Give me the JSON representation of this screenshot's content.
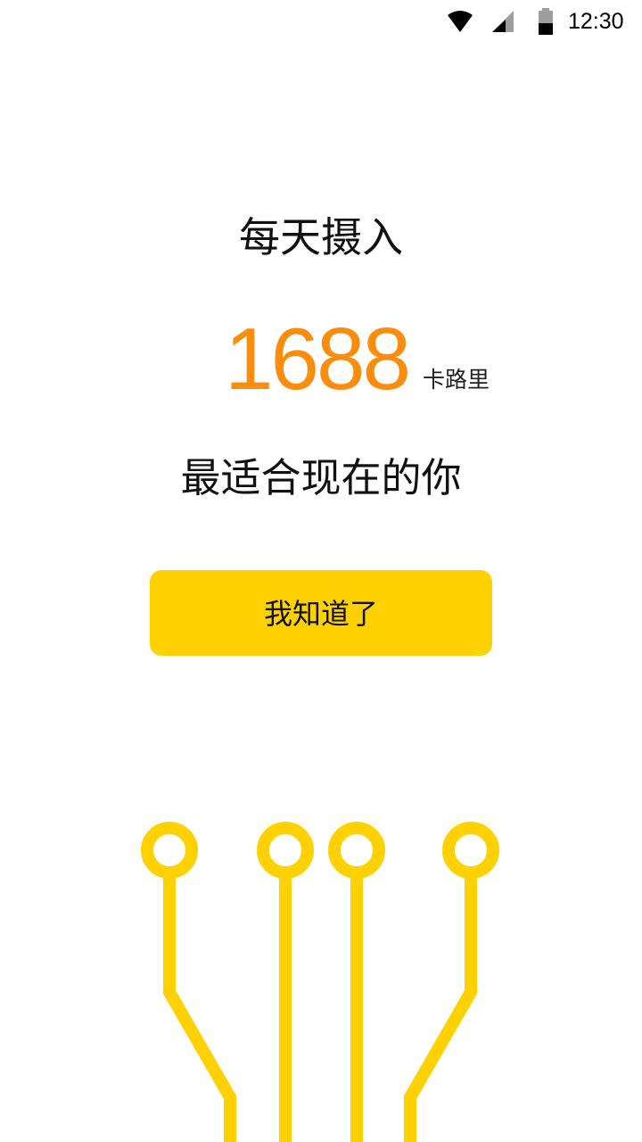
{
  "status_bar": {
    "time": "12:30",
    "icons": [
      "wifi-icon",
      "signal-icon",
      "battery-icon"
    ]
  },
  "main": {
    "title": "每天摄入",
    "calorie_value": "1688",
    "calorie_unit": "卡路里",
    "subtitle": "最适合现在的你",
    "confirm_label": "我知道了"
  },
  "colors": {
    "accent": "#fb8c0c",
    "button": "#ffd100",
    "decoration": "#ffd100",
    "text": "#111111",
    "background": "#ffffff"
  },
  "decoration": {
    "icon": "circuit-lines-icon"
  }
}
